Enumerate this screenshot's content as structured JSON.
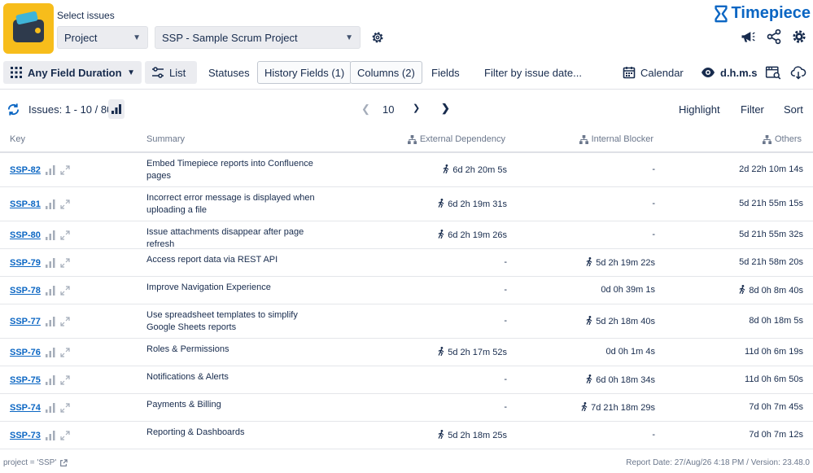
{
  "header": {
    "select_label": "Select issues",
    "scope_dropdown": "Project",
    "project_dropdown": "SSP - Sample Scrum Project",
    "brand": "Timepiece",
    "brand_color": "#0b66c3"
  },
  "toolbar": {
    "duration": "Any Field Duration",
    "list": "List",
    "statuses": "Statuses",
    "history_fields": "History Fields (1)",
    "columns": "Columns (2)",
    "fields": "Fields",
    "filter_by_date": "Filter by issue date...",
    "calendar": "Calendar",
    "time_format": "d.h.m.s"
  },
  "results": {
    "issues_label": "Issues: 1 - 10 / 80",
    "page_size": "10",
    "highlight": "Highlight",
    "filter": "Filter",
    "sort": "Sort"
  },
  "table": {
    "columns": {
      "key": "Key",
      "summary": "Summary",
      "external": "External Dependency",
      "internal": "Internal Blocker",
      "others": "Others"
    },
    "rows": [
      {
        "key": "SSP-82",
        "summary": "Embed Timepiece reports into Confluence pages",
        "ext": "6d 2h 20m 5s",
        "ext_run": true,
        "int": "-",
        "int_run": false,
        "oth": "2d 22h 10m 14s",
        "oth_run": false
      },
      {
        "key": "SSP-81",
        "summary": "Incorrect error message is displayed when uploading a file",
        "ext": "6d 2h 19m 31s",
        "ext_run": true,
        "int": "-",
        "int_run": false,
        "oth": "5d 21h 55m 15s",
        "oth_run": false
      },
      {
        "key": "SSP-80",
        "summary": "Issue attachments disappear after page refresh",
        "ext": "6d 2h 19m 26s",
        "ext_run": true,
        "int": "-",
        "int_run": false,
        "oth": "5d 21h 55m 32s",
        "oth_run": false
      },
      {
        "key": "SSP-79",
        "summary": "Access report data via REST API",
        "ext": "-",
        "ext_run": false,
        "int": "5d 2h 19m 22s",
        "int_run": true,
        "oth": "5d 21h 58m 20s",
        "oth_run": false
      },
      {
        "key": "SSP-78",
        "summary": "Improve Navigation Experience",
        "ext": "-",
        "ext_run": false,
        "int": "0d 0h 39m 1s",
        "int_run": false,
        "oth": "8d 0h 8m 40s",
        "oth_run": true
      },
      {
        "key": "SSP-77",
        "summary": "Use spreadsheet templates to simplify Google Sheets reports",
        "ext": "-",
        "ext_run": false,
        "int": "5d 2h 18m 40s",
        "int_run": true,
        "oth": "8d 0h 18m 5s",
        "oth_run": false
      },
      {
        "key": "SSP-76",
        "summary": "Roles & Permissions",
        "ext": "5d 2h 17m 52s",
        "ext_run": true,
        "int": "0d 0h 1m 4s",
        "int_run": false,
        "oth": "11d 0h 6m 19s",
        "oth_run": false
      },
      {
        "key": "SSP-75",
        "summary": "Notifications & Alerts",
        "ext": "-",
        "ext_run": false,
        "int": "6d 0h 18m 34s",
        "int_run": true,
        "oth": "11d 0h 6m 50s",
        "oth_run": false
      },
      {
        "key": "SSP-74",
        "summary": "Payments & Billing",
        "ext": "-",
        "ext_run": false,
        "int": "7d 21h 18m 29s",
        "int_run": true,
        "oth": "7d 0h 7m 45s",
        "oth_run": false
      },
      {
        "key": "SSP-73",
        "summary": "Reporting & Dashboards",
        "ext": "5d 2h 18m 25s",
        "ext_run": true,
        "int": "-",
        "int_run": false,
        "oth": "7d 0h 7m 12s",
        "oth_run": false
      }
    ]
  },
  "footer": {
    "query": "project = 'SSP'",
    "report_info": "Report Date: 27/Aug/26 4:18 PM / Version: 23.48.0"
  }
}
